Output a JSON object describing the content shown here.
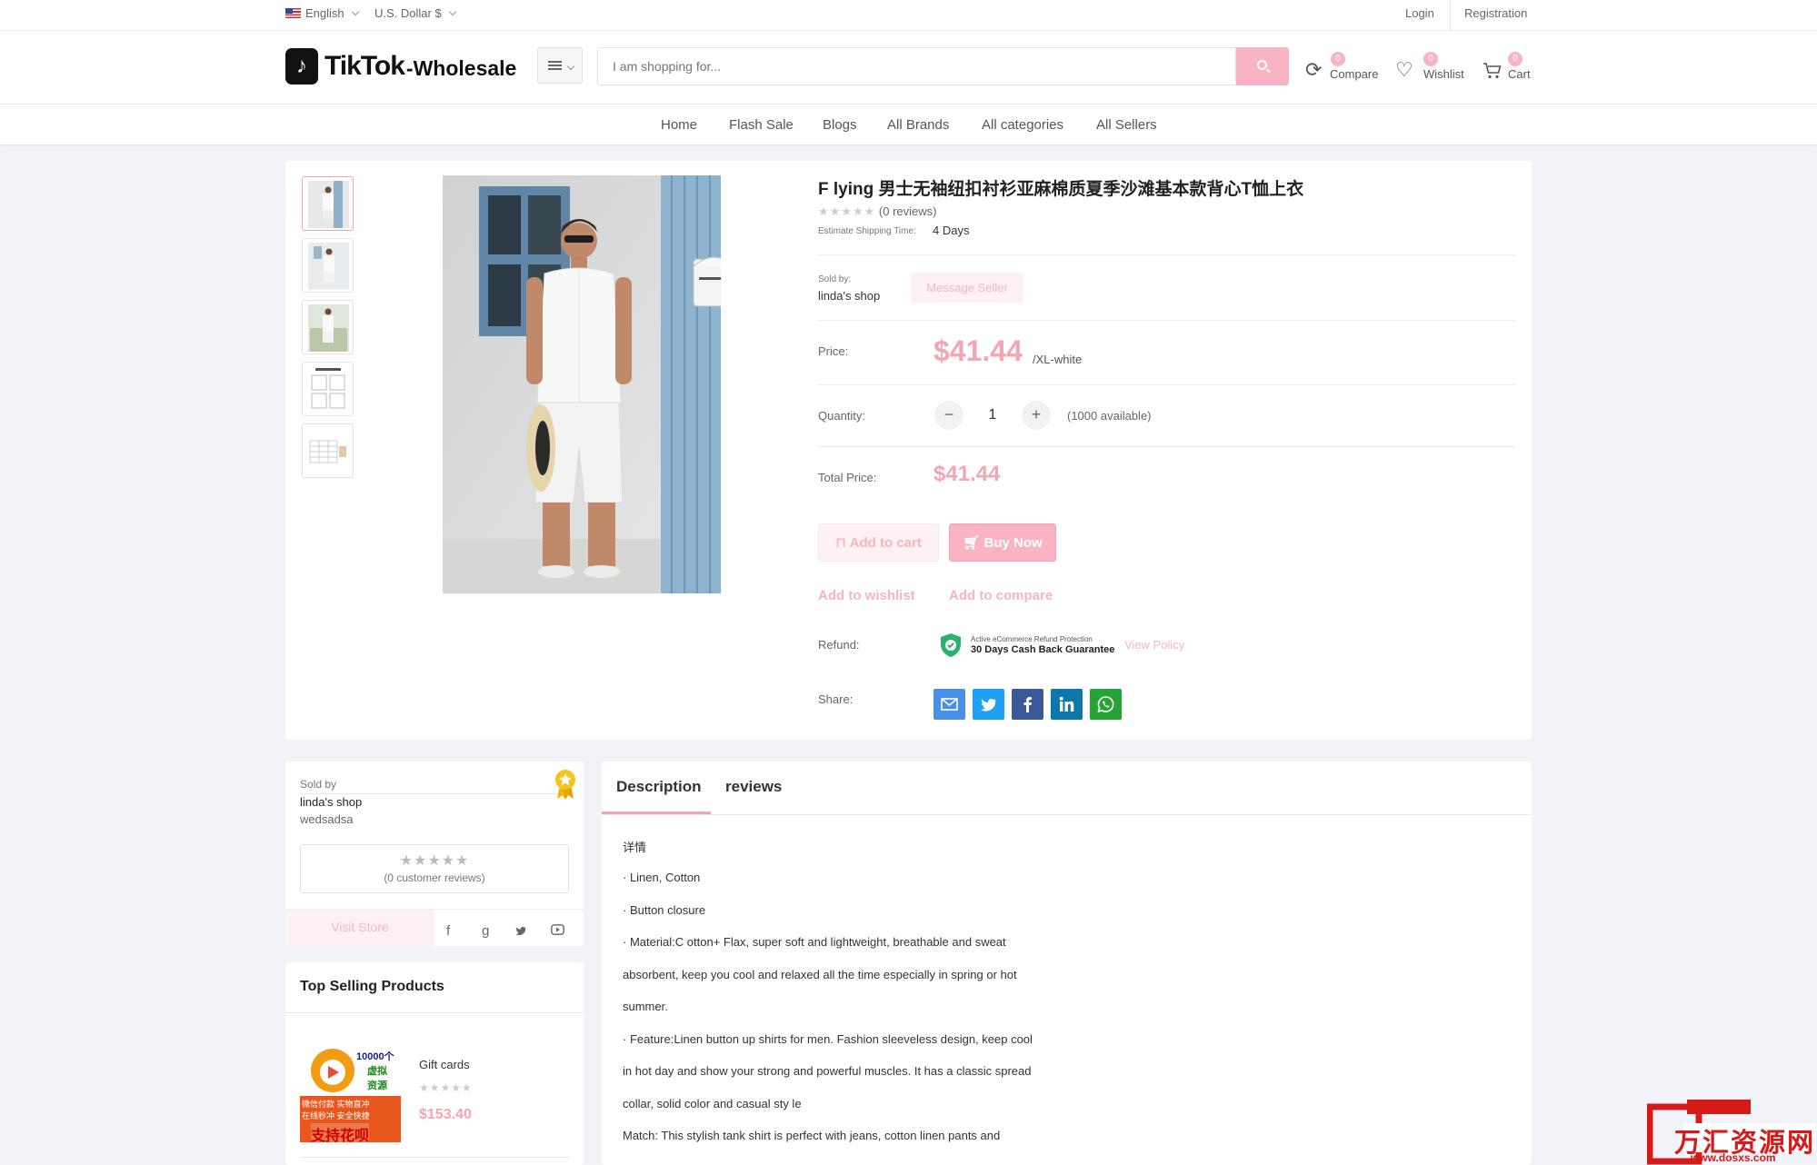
{
  "topbar": {
    "language": "English",
    "currency": "U.S. Dollar $",
    "login": "Login",
    "registration": "Registration"
  },
  "header": {
    "logo_main": "TikTok",
    "logo_suffix": "-Wholesale",
    "search_placeholder": "I am shopping for...",
    "compare": {
      "label": "Compare",
      "count": "0"
    },
    "wishlist": {
      "label": "Wishlist",
      "count": "0"
    },
    "cart": {
      "label": "Cart",
      "count": "0"
    }
  },
  "nav": [
    "Home",
    "Flash Sale",
    "Blogs",
    "All Brands",
    "All categories",
    "All Sellers"
  ],
  "product": {
    "title": "F lying 男士无袖纽扣衬衫亚麻棉质夏季沙滩基本款背心T恤上衣",
    "rating_stars": "★★★★★",
    "reviews": "(0 reviews)",
    "shipping_label": "Estimate Shipping Time:",
    "shipping_value": "4 Days",
    "sold_by_label": "Sold by:",
    "shop_name": "linda's shop",
    "message_seller": "Message Seller",
    "price_label": "Price:",
    "price": "$41.44",
    "variant": "/XL-white",
    "quantity_label": "Quantity:",
    "quantity": "1",
    "available": "(1000 available)",
    "total_label": "Total Price:",
    "total": "$41.44",
    "add_to_cart": "Add to cart",
    "buy_now": "Buy Now",
    "add_to_wishlist": "Add to wishlist",
    "add_to_compare": "Add to compare",
    "refund_label": "Refund:",
    "refund_small": "Active eCommerce Refund Protection",
    "refund_main": "30 Days Cash Back Guarantee",
    "view_policy": "View Policy",
    "share_label": "Share:"
  },
  "seller": {
    "sold_by": "Sold by",
    "name": "linda's shop",
    "sub": "wedsadsa",
    "stars": "★★★★★",
    "customer_reviews": "(0 customer reviews)",
    "visit_store": "Visit Store"
  },
  "top_selling": {
    "title": "Top Selling Products",
    "item": {
      "name": "Gift cards",
      "stars": "★★★★★",
      "price": "$153.40",
      "img_line1": "10000个",
      "img_line2": "虚拟",
      "img_line3": "资源",
      "img_line4": "微信付款 实物直冲",
      "img_line5": "在线秒冲 安全快捷",
      "img_line6": "支持花呗"
    }
  },
  "tabs": {
    "description": "Description",
    "reviews": "reviews"
  },
  "description": [
    "详情",
    "· Linen, Cotton",
    "· Button closure",
    "· Material:C otton+ Flax, super soft and lightweight, breathable and sweat",
    "absorbent, keep you cool and relaxed all the time especially in spring or hot",
    "summer.",
    "·  Feature:Linen button up shirts for men. Fashion sleeveless design, keep cool",
    "in hot day and show your strong and powerful muscles. It has a classic spread",
    "collar, solid color and casual sty le",
    "Match: This stylish tank shirt is perfect with jeans, cotton linen pants and"
  ],
  "watermark": {
    "text": "万汇资源网",
    "url": "www.dosxs.com"
  },
  "colors": {
    "accent": "#f3a5b6",
    "accent_light": "#f9b4c4",
    "bg": "#f2f3f8"
  }
}
